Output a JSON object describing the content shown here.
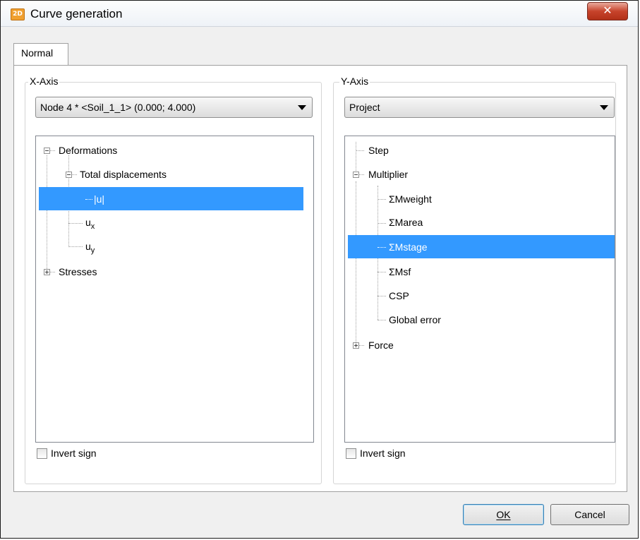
{
  "window": {
    "title": "Curve generation",
    "app_icon_text": "2D",
    "close_symbol": "✕"
  },
  "tabs": [
    {
      "label": "Normal"
    }
  ],
  "x_axis": {
    "label": "X-Axis",
    "combo_value": "Node 4 * <Soil_1_1> (0.000; 4.000)",
    "tree": {
      "deformations": "Deformations",
      "total_displacements": "Total displacements",
      "u_abs": "|u|",
      "ux_base": "u",
      "ux_sub": "x",
      "uy_base": "u",
      "uy_sub": "y",
      "stresses": "Stresses",
      "selected": "|u|"
    },
    "invert_label": "Invert sign",
    "invert_checked": false
  },
  "y_axis": {
    "label": "Y-Axis",
    "combo_value": "Project",
    "tree": {
      "step": "Step",
      "multiplier": "Multiplier",
      "mweight": "ΣMweight",
      "marea": "ΣMarea",
      "mstage": "ΣMstage",
      "msf": "ΣMsf",
      "csp": "CSP",
      "global_error": "Global error",
      "force": "Force",
      "selected": "ΣMstage"
    },
    "invert_label": "Invert sign",
    "invert_checked": false
  },
  "buttons": {
    "ok_label": "OK",
    "cancel_label": "Cancel"
  },
  "colors": {
    "selection": "#3399ff",
    "close_button": "#c7432b"
  }
}
